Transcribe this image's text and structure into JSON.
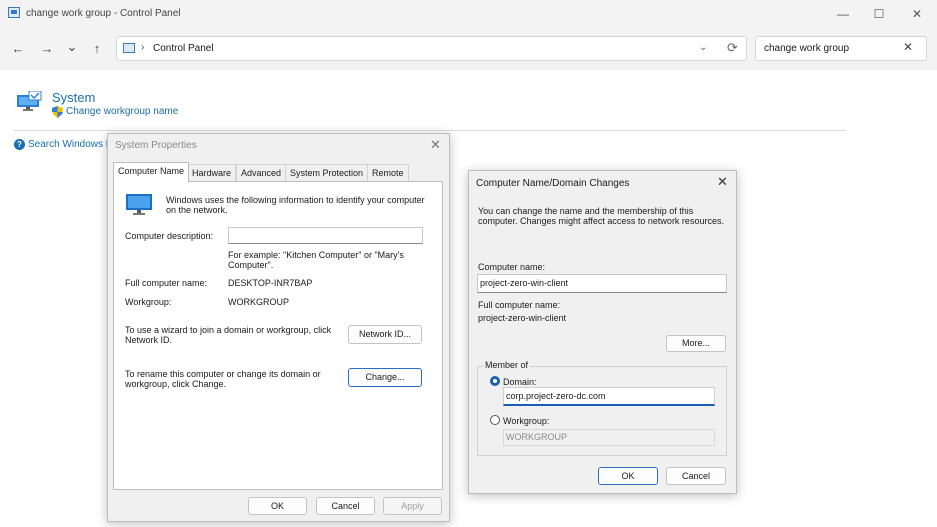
{
  "window": {
    "title": "change work group - Control Panel",
    "minimize_glyph": "—",
    "maximize_glyph": "☐",
    "close_glyph": "✕"
  },
  "nav": {
    "back_glyph": "←",
    "forward_glyph": "→",
    "recent_glyph": "⌄",
    "up_glyph": "↑",
    "address_separator": "›",
    "address_text": "Control Panel",
    "address_dropdown_glyph": "⌄",
    "refresh_glyph": "⟳",
    "search_value": "change work group",
    "search_clear_glyph": "✕"
  },
  "content": {
    "system_title": "System",
    "change_workgroup_link": "Change workgroup name",
    "help_glyph": "?",
    "search_windows_link": "Search Windows Help and Support"
  },
  "system_properties": {
    "title": "System Properties",
    "close_glyph": "✕",
    "tabs": [
      "Computer Name",
      "Hardware",
      "Advanced",
      "System Protection",
      "Remote"
    ],
    "active_tab": "Computer Name",
    "intro": "Windows uses the following information to identify your computer on the network.",
    "description_label": "Computer description:",
    "description_value": "",
    "example_text": "For example: \"Kitchen Computer\" or \"Mary's Computer\".",
    "full_name_label": "Full computer name:",
    "full_name_value": "DESKTOP-INR7BAP",
    "workgroup_label": "Workgroup:",
    "workgroup_value": "WORKGROUP",
    "network_id_text": "To use a wizard to join a domain or workgroup, click Network ID.",
    "network_id_button": "Network ID...",
    "change_text": "To rename this computer or change its domain or workgroup, click Change.",
    "change_button": "Change...",
    "ok_button": "OK",
    "cancel_button": "Cancel",
    "apply_button": "Apply"
  },
  "domain_changes": {
    "title": "Computer Name/Domain Changes",
    "close_glyph": "✕",
    "intro": "You can change the name and the membership of this computer. Changes might affect access to network resources.",
    "computer_name_label": "Computer name:",
    "computer_name_value": "project-zero-win-client",
    "full_name_label": "Full computer name:",
    "full_name_value": "project-zero-win-client",
    "more_button": "More...",
    "member_of_label": "Member of",
    "domain_label": "Domain:",
    "domain_value": "corp.project-zero-dc.com",
    "domain_selected": true,
    "workgroup_label": "Workgroup:",
    "workgroup_value": "WORKGROUP",
    "ok_button": "OK",
    "cancel_button": "Cancel"
  },
  "colors": {
    "link": "#1a6fb0",
    "accent": "#1a5fb4",
    "dialog_bg": "#f0f0f0"
  }
}
